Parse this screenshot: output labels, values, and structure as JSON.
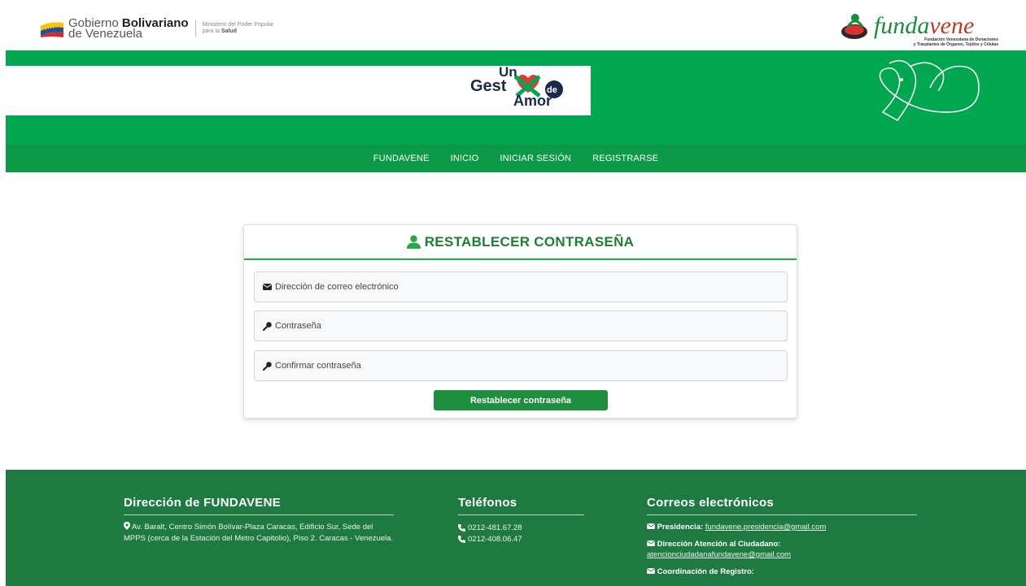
{
  "header": {
    "gov_line1": "Gobierno ",
    "gov_line1_bold": "Bolivariano",
    "gov_line2": "de Venezuela",
    "ministry_line1": "Ministerio del Poder Popular",
    "ministry_line2_pre": "para la ",
    "ministry_line2_bold": "Salud",
    "funda_name_a": "funda",
    "funda_name_b": "vene",
    "funda_sub1": "Fundación Venezolana de Donaciones",
    "funda_sub2": "y Trasplantes de Órganos, Tejidos y Células"
  },
  "banner": {
    "campaign_words": [
      "Un",
      "Gest",
      "de",
      "Amor"
    ]
  },
  "nav": {
    "items": [
      "FUNDAVENE",
      "INICIO",
      "INICIAR SESIÓN",
      "REGISTRARSE"
    ]
  },
  "form": {
    "title": "RESTABLECER CONTRASEÑA",
    "email_placeholder": "Dirección de correo electrónico",
    "password_placeholder": "Contraseña",
    "confirm_placeholder": "Confirmar contraseña",
    "submit_label": "Restablecer contraseña"
  },
  "footer": {
    "address_title": "Dirección de FUNDAVENE",
    "address_text": "Av. Baralt, Centro Simón Bolívar-Plaza Caracas, Edificio Sur, Sede del MPPS (cerca de la Estación del Metro Capitolio), Piso 2. Caracas - Venezuela.",
    "phones_title": "Teléfonos",
    "phones": [
      "0212-481.67.28",
      "0212-408.06.47"
    ],
    "emails_title": "Correos electrónicos",
    "emails": [
      {
        "label": "Presidencia:",
        "address": "fundavene.presidencia@gmail.com"
      },
      {
        "label": "Dirección Atención al Ciudadano:",
        "address": "atencionciudadanafundavene@gmail.com"
      },
      {
        "label": "Coordinación de Registro:",
        "address": ""
      }
    ]
  },
  "colors": {
    "banner_green": "#00a650",
    "nav_green": "#0c9a48",
    "footer_green": "#1f7a41",
    "button_green": "#1e8e3e",
    "title_green": "#1e7e34"
  }
}
